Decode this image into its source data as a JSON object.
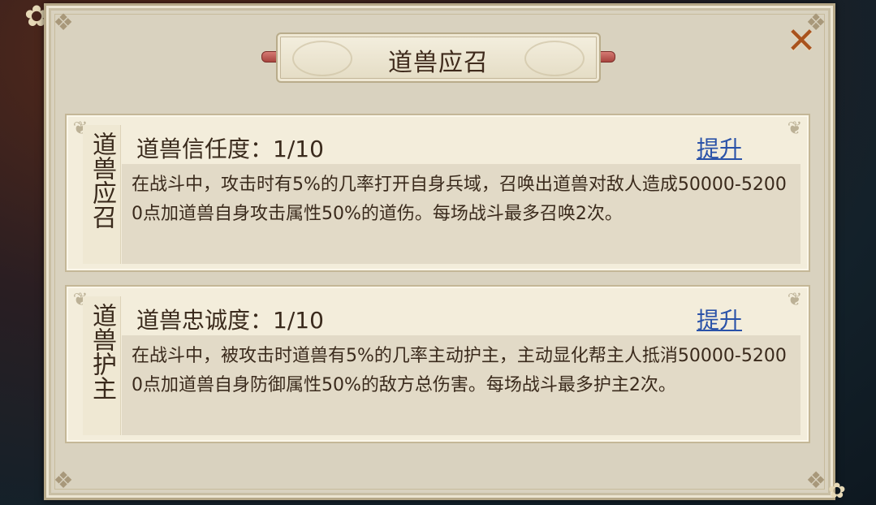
{
  "dialog": {
    "title": "道兽应召",
    "close_icon": "close-icon"
  },
  "panels": [
    {
      "tab_label": "道兽应召",
      "heading": "道兽信任度：1/10",
      "upgrade_label": "提升",
      "description": "在战斗中，攻击时有5%的几率打开自身兵域，召唤出道兽对敌人造成50000-52000点加道兽自身攻击属性50%的道伤。每场战斗最多召唤2次。"
    },
    {
      "tab_label": "道兽护主",
      "heading": "道兽忠诚度：1/10",
      "upgrade_label": "提升",
      "description": "在战斗中，被攻击时道兽有5%的几率主动护主，主动显化帮主人抵消50000-52000点加道兽自身防御属性50%的敌方总伤害。每场战斗最多护主2次。"
    }
  ],
  "colors": {
    "link": "#2a52a8",
    "close": "#a9531e",
    "panel_bg": "#f3eddb",
    "dialog_bg": "#d9d2bf"
  }
}
